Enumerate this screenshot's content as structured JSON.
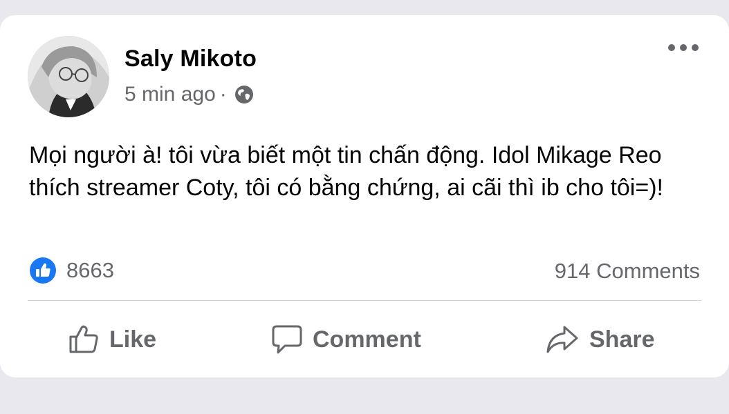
{
  "post": {
    "author": "Saly Mikoto",
    "time": "5 min ago",
    "separator": "·",
    "privacy_icon": "globe-icon",
    "text": "Mọi người à! tôi vừa biết một tin chấn động. Idol Mikage Reo thích streamer Coty, tôi có bằng chứng, ai cãi thì ib cho tôi=)!",
    "like_count": "8663",
    "comments_count": "914 Comments"
  },
  "actions": {
    "like_label": "Like",
    "comment_label": "Comment",
    "share_label": "Share"
  },
  "colors": {
    "background": "#e8e8ee",
    "card": "#ffffff",
    "primary_text": "#050505",
    "secondary_text": "#65676b",
    "like_blue": "#1877f2"
  }
}
